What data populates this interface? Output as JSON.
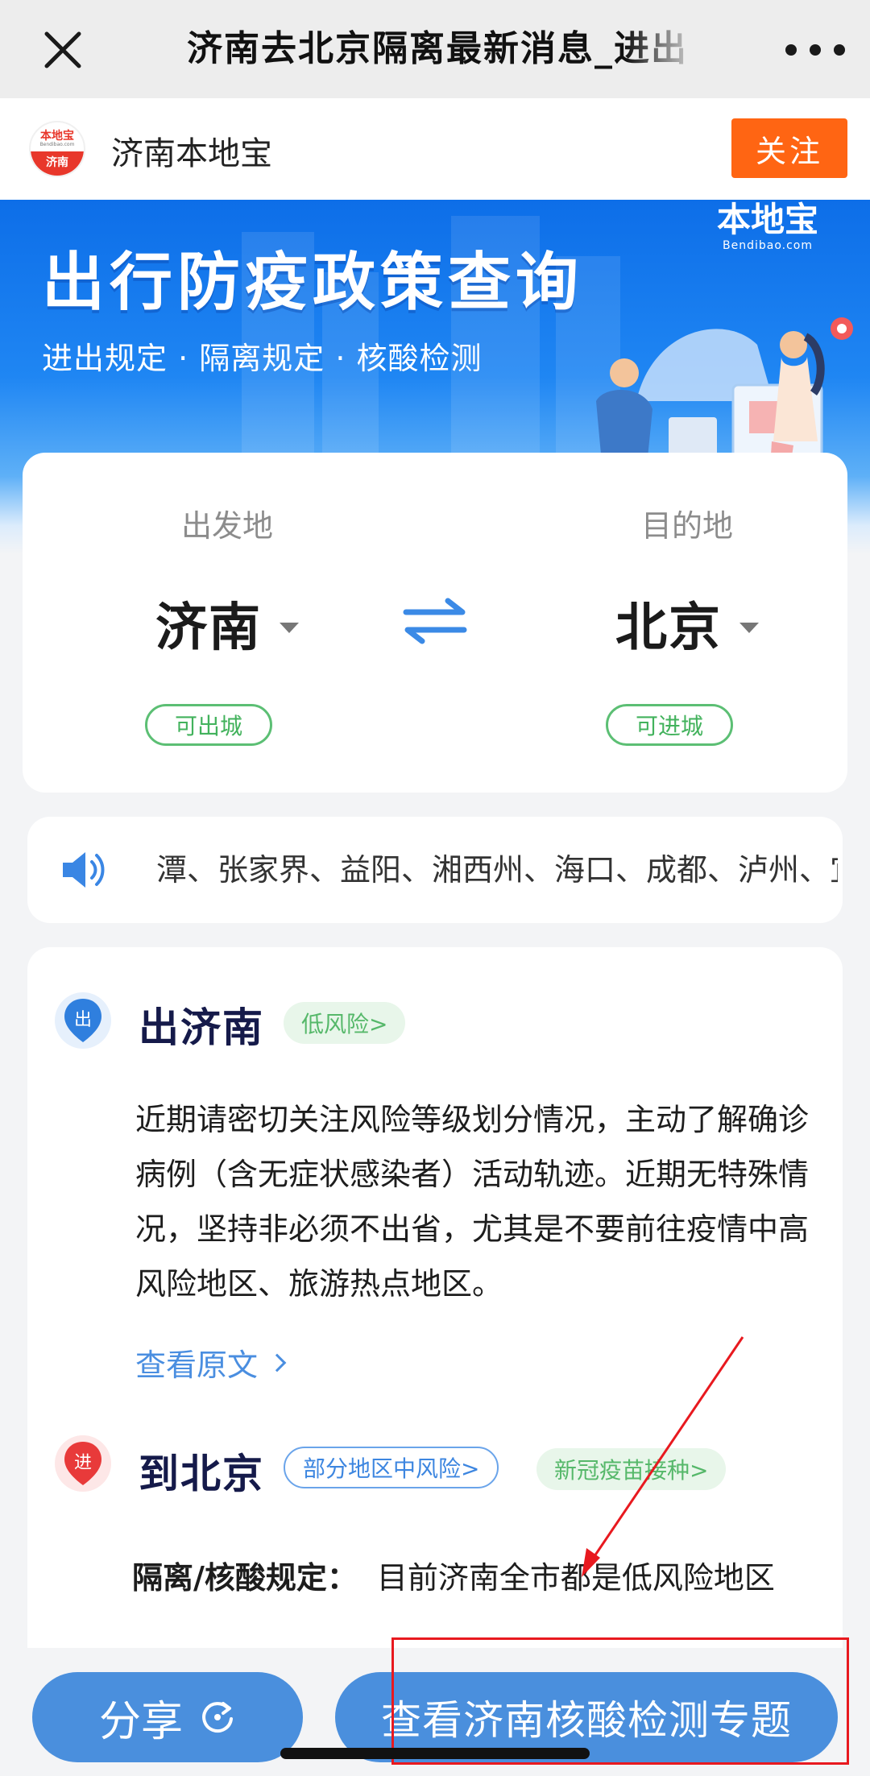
{
  "topbar": {
    "title": "济南去北京隔离最新消息_进出",
    "close_icon": "close-icon",
    "more_icon": "more-dots-icon"
  },
  "account": {
    "logo_line1": "本地宝",
    "logo_line2": "Bendibao.com",
    "logo_line3": "济南",
    "name": "济南本地宝",
    "follow_label": "关注"
  },
  "banner": {
    "title": "出行防疫政策查询",
    "subtitle": "进出规定 · 隔离规定 · 核酸检测",
    "brand_name": "本地宝",
    "brand_url": "Bendibao.com"
  },
  "route": {
    "from_label": "出发地",
    "from_city": "济南",
    "from_status": "可出城",
    "to_label": "目的地",
    "to_city": "北京",
    "to_status": "可进城",
    "swap_icon": "swap-arrows-icon"
  },
  "ticker": {
    "icon": "speaker-icon",
    "text": "潭、张家界、益阳、湘西州、海口、成都、泸州、宜宾"
  },
  "outbound": {
    "badge": "出",
    "title": "出济南",
    "risk": "低风险>",
    "body": "近期请密切关注风险等级划分情况，主动了解确诊病例（含无症状感染者）活动轨迹。近期无特殊情况，坚持非必须不出省，尤其是不要前往疫情中高风险地区、旅游热点地区。",
    "link": "查看原文"
  },
  "inbound": {
    "badge": "进",
    "title": "到北京",
    "risk": "部分地区中风险>",
    "vaccine": "新冠疫苗接种>",
    "rule_key": "隔离/核酸规定：",
    "rule_value": "目前济南全市都是低风险地区"
  },
  "bottom": {
    "share_label": "分享",
    "share_icon": "share-refresh-icon",
    "topic_label": "查看济南核酸检测专题"
  },
  "colors": {
    "banner_blue": "#1f86f3",
    "follow_orange": "#ff6513",
    "button_blue": "#4a8fdd",
    "status_green": "#42b25c",
    "annotation_red": "#e8191f"
  }
}
